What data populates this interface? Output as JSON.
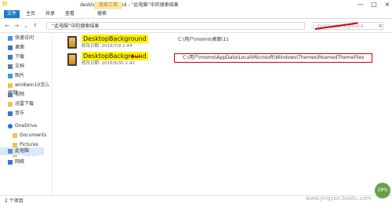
{
  "window": {
    "title": "desktopbackground - “此电脑”中的搜索结果",
    "tab_file": "文件",
    "tab_home": "主页",
    "tab_share": "共享",
    "tab_view": "查看",
    "tab_search": "搜索",
    "search_tools": "搜索工具"
  },
  "address": {
    "path": "“此电脑”中的搜索结果",
    "search_value": "desktopbackground"
  },
  "sidebar": {
    "items": [
      {
        "label": "快速访问"
      },
      {
        "label": "桌面"
      },
      {
        "label": "下载"
      },
      {
        "label": "文档"
      },
      {
        "label": "图片"
      },
      {
        "label": "win8win10怎么找到"
      },
      {
        "label": "视频"
      },
      {
        "label": "迅雷下载"
      },
      {
        "label": "音乐"
      },
      {
        "label": "OneDrive"
      },
      {
        "label": "Documents"
      },
      {
        "label": "Pictures"
      },
      {
        "label": "公用文件"
      },
      {
        "label": "此电脑"
      },
      {
        "label": "网络"
      }
    ]
  },
  "files": [
    {
      "name": "DesktopBackground",
      "meta": "修改日期: 2016/7/9 2:44",
      "path": "C:\\用户\\momo\\桌面\\11"
    },
    {
      "name": "DesktopBackground",
      "meta": "修改日期: 2016/6/30 2:42",
      "path": "C:\\用户\\momo\\AppData\\Local\\Microsoft\\Windows\\Themes\\RoamedThemeFiles"
    }
  ],
  "status": {
    "count": "2 个项目"
  },
  "watermark": {
    "text": "www.jingyan.baidu.com",
    "badge": "29%"
  },
  "colors": {
    "accent": "#1979ca",
    "highlight": "#fff200",
    "annotation_red": "#d40000"
  }
}
